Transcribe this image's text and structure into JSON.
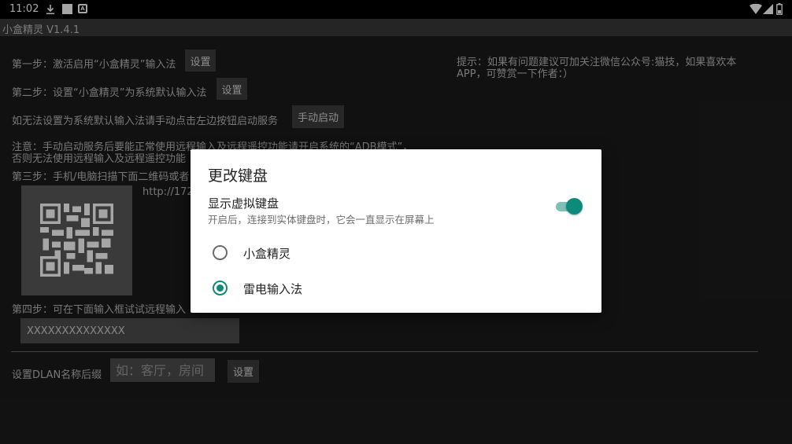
{
  "status_bar": {
    "time": "11:02",
    "icons": [
      "download-icon",
      "square-icon",
      "a-icon",
      "wifi-icon",
      "signal-icon",
      "battery-icon"
    ]
  },
  "app_bar": {
    "title": "小盒精灵  V1.4.1"
  },
  "main": {
    "step1": {
      "text": "第一步：激活启用“小盒精灵”输入法",
      "button": "设置"
    },
    "step2": {
      "text": "第二步：设置“小盒精灵”为系统默认输入法",
      "button": "设置"
    },
    "manual": {
      "text": "如无法设置为系统默认输入法请手动点击左边按钮启动服务",
      "button": "手动启动"
    },
    "note_line1": "注意：手动启动服务后要能正常使用远程输入及远程遥控功能请开启系统的“ADB模式”，",
    "note_line2": "否则无法使用远程输入及远程遥控功能",
    "step3": "第三步：手机/电脑扫描下面二维码或者",
    "url": "http://172",
    "step4": "第四步：可在下面输入框试试远程输入",
    "test_input_value": "XXXXXXXXXXXXXX",
    "tip_line1": "提示：如果有问题建议可加关注微信公众号:猫技，如果喜欢本",
    "tip_line2": "APP，可赞赏一下作者：）",
    "dlan": {
      "label": "设置DLAN名称后缀",
      "placeholder": "如：客厅，房间",
      "button": "设置"
    }
  },
  "dialog": {
    "title": "更改键盘",
    "toggle_label": "显示虚拟键盘",
    "toggle_desc": "开启后，连接到实体键盘时，它会一直显示在屏幕上",
    "toggle_on": true,
    "options": [
      {
        "label": "小盒精灵",
        "selected": false
      },
      {
        "label": "雷电输入法",
        "selected": true
      }
    ]
  },
  "colors": {
    "accent": "#0e8a7b",
    "accent_track": "#7fbfb6",
    "background": "#1b1b1b"
  }
}
